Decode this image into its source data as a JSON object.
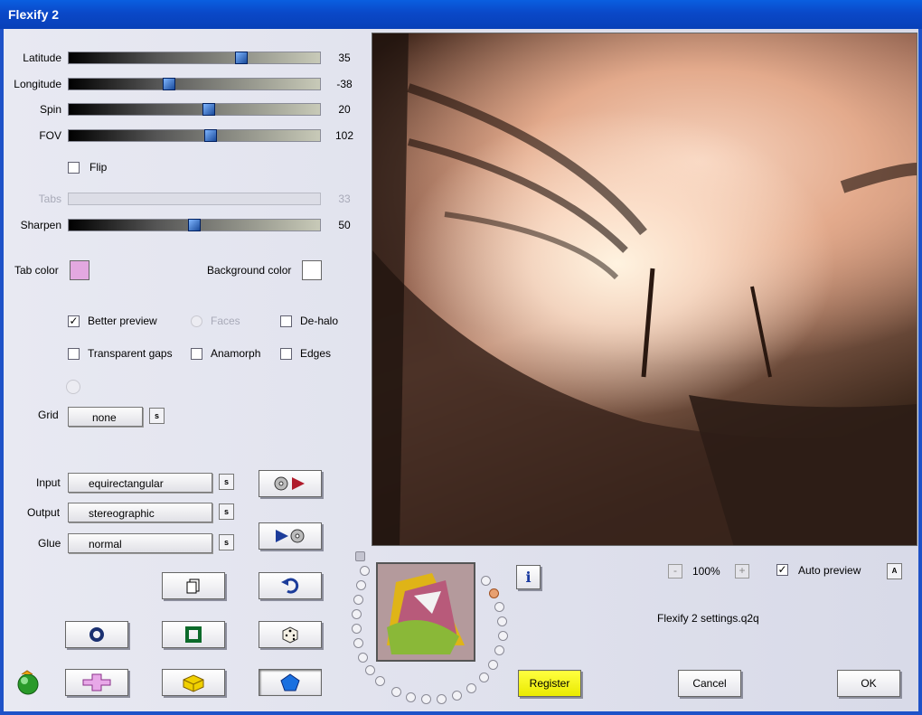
{
  "window": {
    "title": "Flexify 2"
  },
  "sliders": [
    {
      "label": "Latitude",
      "value": "35",
      "level": 0.68,
      "disabled": false
    },
    {
      "label": "Longitude",
      "value": "-38",
      "level": 0.4,
      "disabled": false
    },
    {
      "label": "Spin",
      "value": "20",
      "level": 0.56,
      "disabled": false
    },
    {
      "label": "FOV",
      "value": "102",
      "level": 0.57,
      "disabled": false
    },
    {
      "label": "Tabs",
      "value": "33",
      "level": 0,
      "disabled": true
    },
    {
      "label": "Sharpen",
      "value": "50",
      "level": 0.5,
      "disabled": false
    }
  ],
  "flip": {
    "label": "Flip",
    "checked": false
  },
  "colors": {
    "tab_label": "Tab color",
    "tab_value": "#e3a8e0",
    "bg_label": "Background color",
    "bg_value": "#ffffff"
  },
  "options": {
    "better_preview": {
      "label": "Better preview",
      "checked": true
    },
    "faces": {
      "label": "Faces",
      "checked": false
    },
    "dehalo": {
      "label": "De-halo",
      "checked": false
    },
    "transparent_gaps": {
      "label": "Transparent gaps",
      "checked": false
    },
    "anamorph": {
      "label": "Anamorph",
      "checked": false
    },
    "edges": {
      "label": "Edges",
      "checked": false
    }
  },
  "grid": {
    "label": "Grid",
    "value": "none"
  },
  "selectors": [
    {
      "label": "Input",
      "value": "equirectangular"
    },
    {
      "label": "Output",
      "value": "stereographic"
    },
    {
      "label": "Glue",
      "value": "normal"
    }
  ],
  "zoom": {
    "value": "100%",
    "minus": "-",
    "plus": "+"
  },
  "auto_preview": {
    "label": "Auto preview",
    "checked": true,
    "menu": "A"
  },
  "settings_file": "Flexify 2 settings.q2q",
  "buttons": {
    "register": "Register",
    "cancel": "Cancel",
    "ok": "OK",
    "info": "i",
    "s": "s"
  }
}
